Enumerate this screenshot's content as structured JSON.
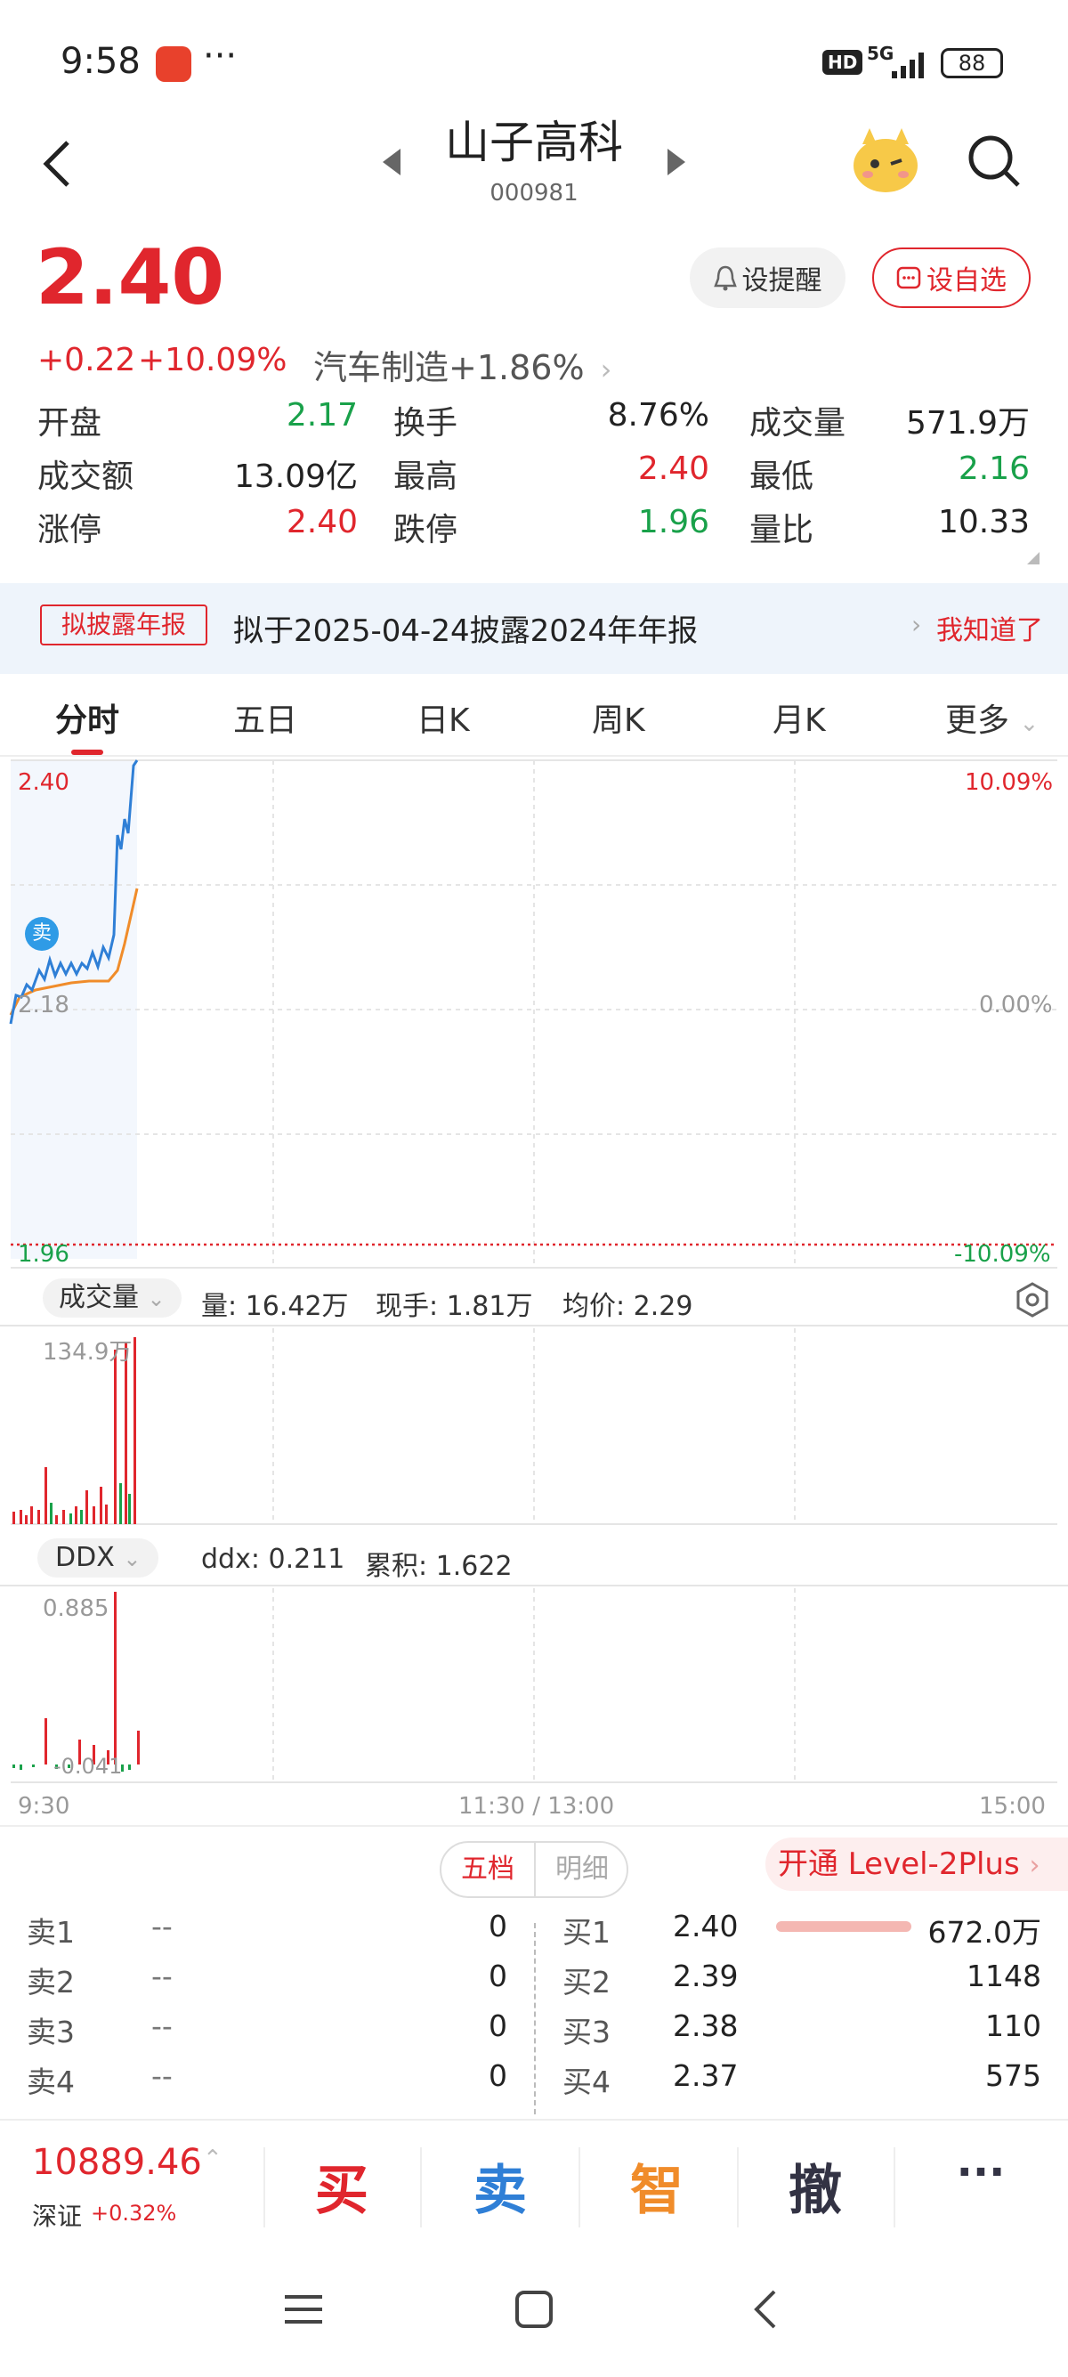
{
  "status": {
    "time": "9:58",
    "dots": "···",
    "hd": "HD",
    "network": "5G",
    "battery": "88"
  },
  "header": {
    "title": "山子高科",
    "code": "000981"
  },
  "quote": {
    "price": "2.40",
    "change": "+0.22",
    "change_pct": "+10.09%",
    "sector": "汽车制造",
    "sector_pct": "+1.86%",
    "remind_label": "设提醒",
    "watch_label": "设自选"
  },
  "stats": [
    [
      {
        "label": "开盘",
        "value": "2.17",
        "color": "green"
      },
      {
        "label": "换手",
        "value": "8.76%",
        "color": "black"
      },
      {
        "label": "成交量",
        "value": "571.9万",
        "color": "black"
      }
    ],
    [
      {
        "label": "成交额",
        "value": "13.09亿",
        "color": "black"
      },
      {
        "label": "最高",
        "value": "2.40",
        "color": "red"
      },
      {
        "label": "最低",
        "value": "2.16",
        "color": "green"
      }
    ],
    [
      {
        "label": "涨停",
        "value": "2.40",
        "color": "red"
      },
      {
        "label": "跌停",
        "value": "1.96",
        "color": "green"
      },
      {
        "label": "量比",
        "value": "10.33",
        "color": "black"
      }
    ]
  ],
  "notice": {
    "tag": "拟披露年报",
    "text": "拟于2025-04-24披露2024年年报",
    "action": "我知道了"
  },
  "tabs": [
    "分时",
    "五日",
    "日K",
    "周K",
    "月K",
    "更多"
  ],
  "chart": {
    "price_high": "2.40",
    "price_mid": "2.18",
    "price_low": "1.96",
    "pct_high": "10.09%",
    "pct_mid": "0.00%",
    "pct_low": "-10.09%",
    "sell_marker": "卖",
    "time_start": "9:30",
    "time_mid": "11:30 / 13:00",
    "time_end": "15:00"
  },
  "volume": {
    "selector": "成交量",
    "vol": "量: 16.42万",
    "now_hand": "现手: 1.81万",
    "avg_price": "均价: 2.29",
    "max_label": "134.9万"
  },
  "ddx": {
    "selector": "DDX",
    "ddx": "ddx: 0.211",
    "cumulative": "累积: 1.622",
    "max_label": "0.885",
    "min_label": "-0.041"
  },
  "orderbook": {
    "tab_active": "五档",
    "tab_inactive": "明细",
    "level2": "开通 Level-2Plus",
    "sells": [
      {
        "label": "卖1",
        "price": "--",
        "qty": "0"
      },
      {
        "label": "卖2",
        "price": "--",
        "qty": "0"
      },
      {
        "label": "卖3",
        "price": "--",
        "qty": "0"
      },
      {
        "label": "卖4",
        "price": "--",
        "qty": "0"
      }
    ],
    "buys": [
      {
        "label": "买1",
        "price": "2.40",
        "qty": "672.0万"
      },
      {
        "label": "买2",
        "price": "2.39",
        "qty": "1148"
      },
      {
        "label": "买3",
        "price": "2.38",
        "qty": "110"
      },
      {
        "label": "买4",
        "price": "2.37",
        "qty": "575"
      }
    ]
  },
  "bottom": {
    "index_value": "10889.46",
    "index_name": "深证",
    "index_pct": "+0.32%",
    "buy": "买",
    "sell": "卖",
    "smart": "智",
    "cancel": "撤",
    "more": "···"
  },
  "colors": {
    "red": "#e0262d",
    "green": "#19a14a",
    "blue": "#2f7fd6",
    "orange": "#f08c2a"
  }
}
